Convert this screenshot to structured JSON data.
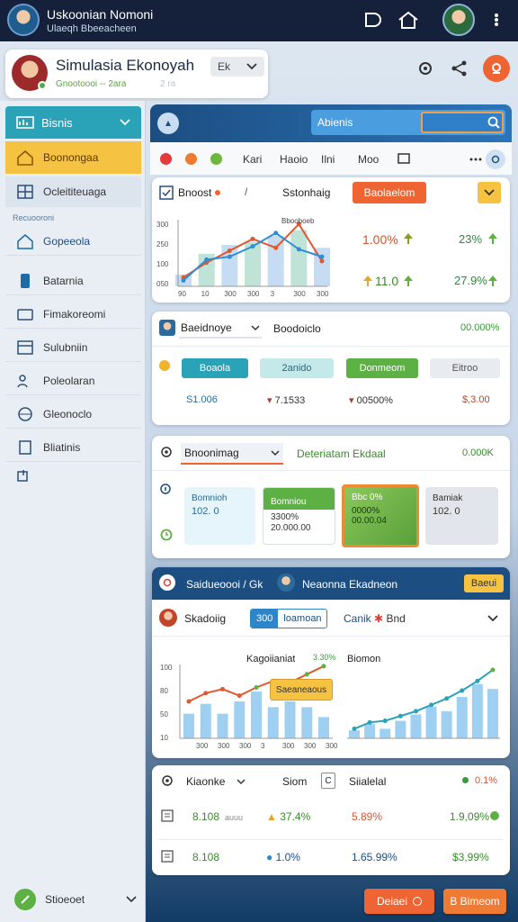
{
  "app": {
    "title": "Uskoonian Nomoni",
    "subtitle": "Ulaeqh Bbeeacheen"
  },
  "header": {
    "title": "Simulasia Ekonoyah",
    "subtitle_main": "Gnootoooi -- 2ara",
    "subtitle_faint": "2 ra",
    "dropdown": "Ek"
  },
  "sidebar": {
    "top": "Bisnis",
    "items": [
      {
        "label": "Boonongaa",
        "icon": "home-icon"
      },
      {
        "label": "Ocleititeuaga",
        "icon": "grid-icon"
      }
    ],
    "section": "Recuooroni",
    "items2": [
      {
        "label": "Gopeeola",
        "icon": "house-icon"
      },
      {
        "label": "Batarnia",
        "icon": "phone-icon"
      },
      {
        "label": "Fimakoreomi",
        "icon": "card-icon"
      },
      {
        "label": "Sulubniin",
        "icon": "table-icon"
      },
      {
        "label": "Poleolaran",
        "icon": "people-icon"
      },
      {
        "label": "Gleonoclo",
        "icon": "globe-icon"
      },
      {
        "label": "Bliatinis",
        "icon": "book-icon"
      }
    ],
    "bottom": "Stioeoet"
  },
  "topbar": {
    "search": "Abienis"
  },
  "toolbar": {
    "tabs": [
      "Kari",
      "Haoio",
      "Ilni",
      "Moo"
    ]
  },
  "card1": {
    "title": "Bnoost",
    "filter": "Sstonhaig",
    "action": "Baolaelom",
    "tick_y": [
      "300",
      "250",
      "100",
      "050"
    ],
    "tick_x": [
      "90",
      "10",
      "300",
      "300",
      "3",
      "300",
      "300"
    ],
    "point_label": "Bbooboeb",
    "stats": [
      {
        "value": "1.00%",
        "badge": "4",
        "right": "23%",
        "right_badge": "4"
      },
      {
        "value": "11.0",
        "badge": "4",
        "right": "27.9%",
        "right_badge": "4"
      }
    ]
  },
  "card2": {
    "title": "Baeidnoye",
    "subtitle": "Boodoiclo",
    "right": "00.000%",
    "pills": [
      "Boaola",
      "2anido",
      "Donmeom",
      "Eitroo"
    ],
    "values": [
      "S1.006",
      "7.1533",
      "00500%",
      "$,3.00"
    ]
  },
  "card3": {
    "select": "Bnoonimag",
    "title": "Deteriatam Ekdaal",
    "right": "0.000K",
    "tiles": [
      {
        "t": "Bomnioh",
        "v": "102. 0"
      },
      {
        "t": "Bomniou",
        "v": "3300%",
        "v2": "20.000.00"
      },
      {
        "t": "Bbc 0%",
        "v": "0000%",
        "v2": "00.00.04"
      },
      {
        "t": "Bamiak",
        "v": "102. 0"
      }
    ]
  },
  "card4": {
    "title": "Saidueoooi / Gk",
    "person": "Neaonna Ekadneon",
    "btn": "Baeui",
    "tab1": "Skadoiig",
    "pill_a": "300",
    "pill_b": "loamoan",
    "sel_a": "Canik",
    "sel_b": "Bnd",
    "chart1_title": "Kagoiianiat",
    "chart1_badge": "3.30%",
    "chart2_title": "Biomon",
    "label": "Saeaneaous",
    "tick_y": [
      "100",
      "80",
      "50",
      "10"
    ],
    "tick_x": [
      "300",
      "300",
      "300",
      "3",
      "300",
      "300",
      "300"
    ]
  },
  "card5": {
    "header": [
      "Kiaonke",
      "Siom",
      "Siialelal"
    ],
    "header_right": "0.1%",
    "rows": [
      {
        "a": "8.108",
        "b": "auuu",
        "c": "37.4%",
        "d": "5.89%",
        "e": "1.9,09%"
      },
      {
        "a": "8.108",
        "b": "",
        "c": "1.0%",
        "d": "1.65.99%",
        "e": "$3,99%"
      }
    ]
  },
  "footer": {
    "btn1": "Deiaei",
    "btn2": "B Bimeom"
  },
  "colors": {
    "nav": "#1a2c4e",
    "accent_blue": "#2f86c6",
    "orange": "#ee6533",
    "green": "#5db043",
    "yellow": "#f3c744",
    "teal": "#2aa2b7"
  },
  "chart_data": [
    {
      "type": "line",
      "title": "",
      "x": [
        "90",
        "10",
        "300",
        "300",
        "3",
        "300",
        "300"
      ],
      "series": [
        {
          "name": "",
          "values": [
            6,
            16,
            24,
            32,
            26,
            42,
            17
          ]
        },
        {
          "name": "",
          "values": [
            4,
            18,
            20,
            27,
            36,
            25,
            20
          ]
        }
      ],
      "bars": [
        8,
        22,
        28,
        30,
        34,
        38,
        26
      ]
    },
    {
      "type": "bar",
      "title": "",
      "series": [
        {
          "name": "",
          "values": [
            30,
            42,
            30,
            45,
            57,
            38,
            45,
            38,
            26
          ]
        },
        {
          "name": "",
          "values": [
            45,
            55,
            60,
            52,
            62,
            70,
            68,
            78,
            88
          ]
        }
      ]
    },
    {
      "type": "bar",
      "title": "",
      "series": [
        {
          "name": "",
          "values": [
            10,
            18,
            12,
            22,
            30,
            40,
            34,
            52,
            68,
            62
          ]
        },
        {
          "name": "",
          "values": [
            12,
            20,
            22,
            28,
            34,
            42,
            50,
            60,
            72,
            86
          ]
        }
      ]
    }
  ]
}
